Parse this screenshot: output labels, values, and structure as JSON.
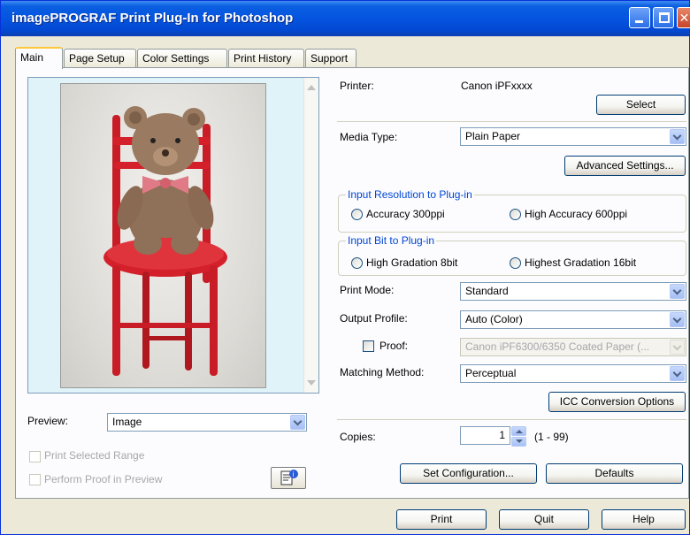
{
  "window": {
    "title": "imagePROGRAF Print Plug-In for Photoshop",
    "controls": [
      "minimize",
      "maximize",
      "close"
    ]
  },
  "tabs": [
    {
      "label": "Main",
      "active": true
    },
    {
      "label": "Page Setup",
      "active": false
    },
    {
      "label": "Color Settings",
      "active": false
    },
    {
      "label": "Print History",
      "active": false
    },
    {
      "label": "Support",
      "active": false
    }
  ],
  "preview": {
    "label": "Preview:",
    "value": "Image",
    "print_selected_range": "Print Selected Range",
    "perform_proof": "Perform Proof in Preview",
    "info_icon": "info-document-icon"
  },
  "printer": {
    "label": "Printer:",
    "value": "Canon iPFxxxx",
    "select_button": "Select"
  },
  "media_type": {
    "label": "Media Type:",
    "value": "Plain Paper",
    "advanced_button": "Advanced Settings..."
  },
  "input_resolution": {
    "title": "Input Resolution to Plug-in",
    "option1": "Accuracy 300ppi",
    "option2": "High Accuracy 600ppi"
  },
  "input_bit": {
    "title": "Input Bit to Plug-in",
    "option1": "High Gradation 8bit",
    "option2": "Highest Gradation 16bit"
  },
  "print_mode": {
    "label": "Print Mode:",
    "value": "Standard"
  },
  "output_profile": {
    "label": "Output Profile:",
    "value": "Auto (Color)"
  },
  "proof": {
    "label": "Proof:",
    "value": "Canon iPF6300/6350 Coated Paper (..."
  },
  "matching": {
    "label": "Matching Method:",
    "value": "Perceptual"
  },
  "icc_button": "ICC Conversion Options",
  "copies": {
    "label": "Copies:",
    "value": "1",
    "range": "(1 - 99)"
  },
  "set_config_button": "Set Configuration...",
  "defaults_button": "Defaults",
  "footer": {
    "print": "Print",
    "quit": "Quit",
    "help": "Help"
  },
  "colors": {
    "title_bar": "#0554e0",
    "group_title": "#0046d5",
    "preview_bg": "#dff3f9",
    "chair_red": "#d4202a"
  }
}
